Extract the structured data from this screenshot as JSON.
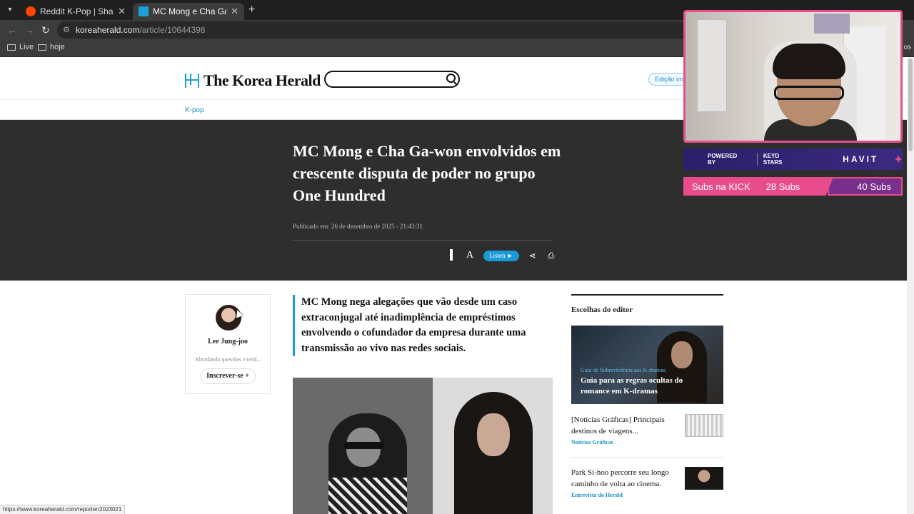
{
  "browser": {
    "tabs": [
      {
        "title": "Reddit K-Pop | Share and discov",
        "active": false
      },
      {
        "title": "MC Mong e Cha Ga-won envolv",
        "active": true
      }
    ],
    "url_domain": "koreaherald.com",
    "url_path": "/article/10644398",
    "bookmarks": [
      "Live",
      "hoje"
    ],
    "bookmarks_right": "os",
    "status_url": "https://www.koreaherald.com/reporter/2023021"
  },
  "site": {
    "logo": "The Korea Herald",
    "edition_label": "Edição imp",
    "section": "K-pop"
  },
  "article": {
    "headline": "MC Mong e Cha Ga-won envolvidos em crescente disputa de poder no grupo One Hundred",
    "published": "Publicado em: 26 de dezembro de 2025 - 21:43:31",
    "listen_label": "Listen ►",
    "font_tool": "A",
    "lede": "MC Mong nega alegações que vão desde um caso extraconjugal até inadimplência de empréstimos envolvendo o cofundador da empresa durante uma transmissão ao vivo nas redes sociais."
  },
  "author": {
    "name": "Lee Jung-joo",
    "desc": "Abordando questões e tend...",
    "subscribe_label": "Inscrever-se +"
  },
  "sidebar": {
    "title": "Escolhas do editor",
    "feature": {
      "category": "Guia de Sobrevivência aos K-dramas",
      "title": "Guia para as regras ocultas do romance em K-dramas"
    },
    "items": [
      {
        "title": "[Notícias Gráficas] Principais destinos de viagens...",
        "category": "Notícias Gráficas"
      },
      {
        "title": "Park Si-hoo percorre seu longo caminho de volta ao cinema.",
        "category": "Entrevista do Herald"
      }
    ]
  },
  "overlay": {
    "sponsor_powered": "POWERED BY",
    "sponsor_keyd": "KEYD STARS",
    "sponsor_havit": "HAVIT",
    "subs_label": "Subs na KICK",
    "subs_count": "28 Subs",
    "subs_goal": "40 Subs"
  },
  "colors": {
    "accent": "#1a9ad8",
    "overlay_pink": "#e84c8a"
  }
}
